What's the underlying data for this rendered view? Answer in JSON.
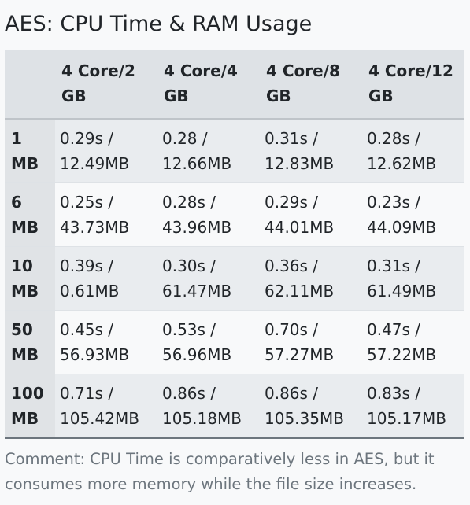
{
  "title": "AES: CPU Time & RAM Usage",
  "table": {
    "columns": [
      "",
      "4 Core/2 GB",
      "4 Core/4 GB",
      "4 Core/8 GB",
      "4 Core/12 GB"
    ],
    "rows": [
      {
        "label": "1 MB",
        "cells": [
          "0.29s / 12.49MB",
          "0.28 / 12.66MB",
          "0.31s / 12.83MB",
          "0.28s / 12.62MB"
        ]
      },
      {
        "label": "6 MB",
        "cells": [
          "0.25s / 43.73MB",
          "0.28s / 43.96MB",
          "0.29s / 44.01MB",
          "0.23s / 44.09MB"
        ]
      },
      {
        "label": "10 MB",
        "cells": [
          "0.39s / 0.61MB",
          "0.30s / 61.47MB",
          "0.36s / 62.11MB",
          "0.31s / 61.49MB"
        ]
      },
      {
        "label": "50 MB",
        "cells": [
          "0.45s / 56.93MB",
          "0.53s / 56.96MB",
          "0.70s / 57.27MB",
          "0.47s / 57.22MB"
        ]
      },
      {
        "label": "100 MB",
        "cells": [
          "0.71s / 105.42MB",
          "0.86s / 105.18MB",
          "0.86s / 105.35MB",
          "0.83s / 105.17MB"
        ]
      }
    ]
  },
  "comment": "Comment: CPU Time is comparatively less in AES, but it consumes more memory while the file size increases."
}
